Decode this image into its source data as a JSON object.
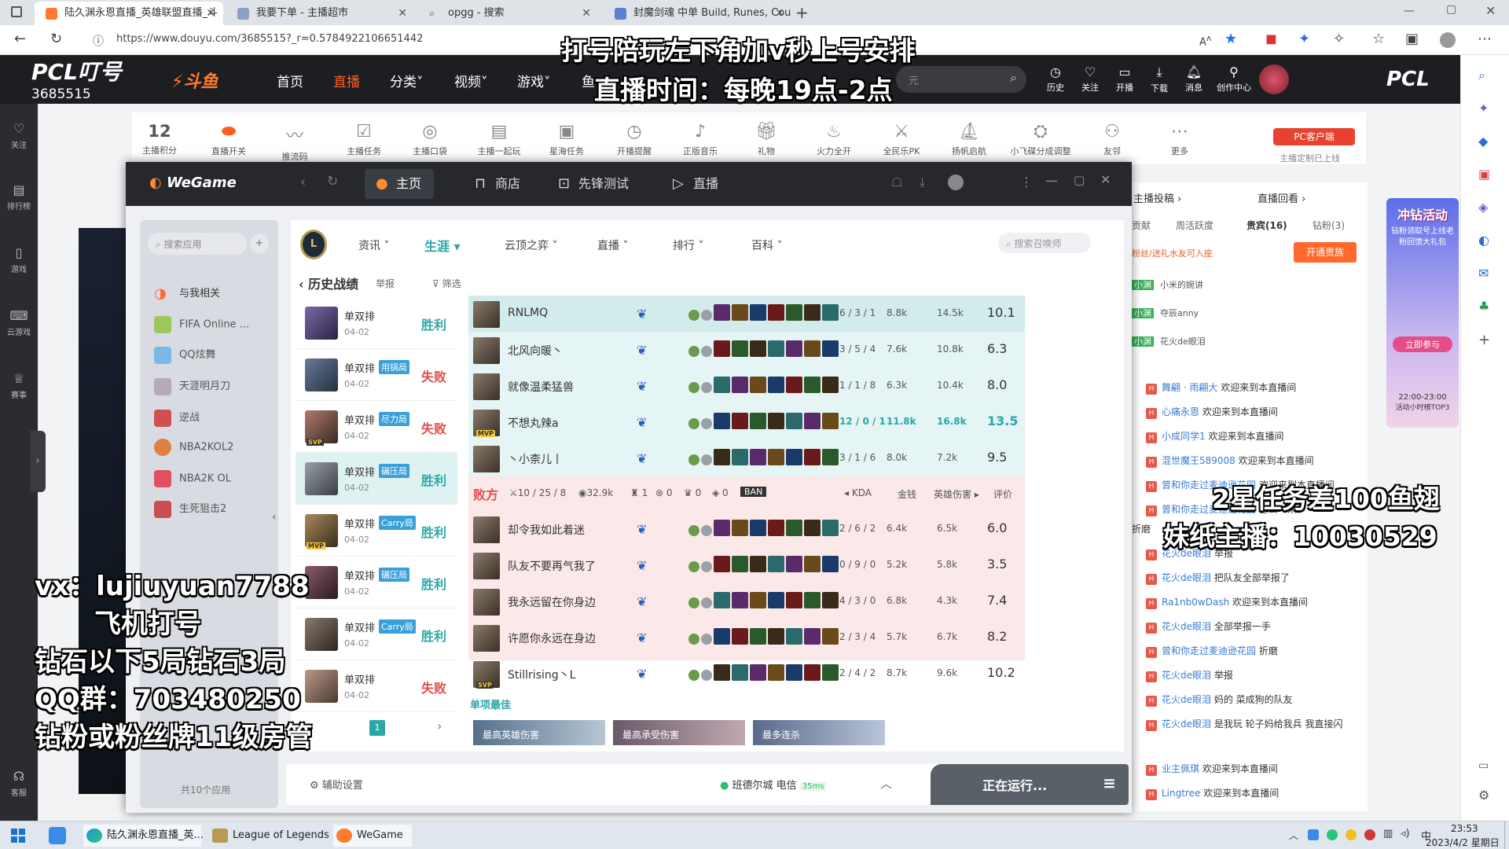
{
  "browser": {
    "tabs": [
      {
        "label": "陆久渊永恩直播_英雄联盟直播_斗",
        "active": true
      },
      {
        "label": "我要下单 - 主播超市",
        "active": false
      },
      {
        "label": "opgg - 搜索",
        "active": false
      },
      {
        "label": "封魔剑魂 中单 Build, Runes, Cou",
        "active": false
      }
    ],
    "url": "https://www.douyu.com/3685515?_r=0.5784922106651442"
  },
  "douyu": {
    "room_logo": "PCL叮号",
    "room_number": "3685515",
    "brand": "斗鱼",
    "nav": [
      "首页",
      "直播",
      "分类",
      "视频",
      "游戏",
      "鱼"
    ],
    "search_placeholder": "元",
    "header_icons": [
      "历史",
      "关注",
      "开播",
      "下载",
      "消息",
      "创作中心"
    ],
    "right_logo": "PCL",
    "left_rail": [
      "关注",
      "排行榜",
      "游戏",
      "云游戏",
      "赛事",
      "客服"
    ],
    "toolbar": [
      {
        "label": "主播积分",
        "value": "12"
      },
      {
        "label": "直播开关"
      },
      {
        "label": "推流码"
      },
      {
        "label": "主播任务"
      },
      {
        "label": "主播口袋"
      },
      {
        "label": "主播一起玩"
      },
      {
        "label": "星海任务"
      },
      {
        "label": "开播提醒"
      },
      {
        "label": "正版音乐"
      },
      {
        "label": "礼物"
      },
      {
        "label": "火力全开"
      },
      {
        "label": "全民乐PK"
      },
      {
        "label": "扬帆启航"
      },
      {
        "label": "小飞碟分成调整"
      },
      {
        "label": "友邻"
      },
      {
        "label": "更多"
      }
    ],
    "pc_client_button": "PC客户端",
    "pc_client_note": "主播定制已上线"
  },
  "chat": {
    "tabs": [
      "主播投稿",
      "直播回看"
    ],
    "subtabs": [
      "贡献",
      "周活跃度",
      "贵宾(16)",
      "钻粉(3)"
    ],
    "vip_button": "开通贵族",
    "notice": "粉丝/送礼水友可入座",
    "fans": [
      {
        "user": "小米的婉讲"
      },
      {
        "user": "夺辰anny"
      },
      {
        "user": "花火de眼泪"
      }
    ],
    "messages": [
      {
        "user": "舞翩 · 雨翩大",
        "text": "欢迎来到本直播间"
      },
      {
        "user": "心痛永恩",
        "text": "欢迎来到本直播间"
      },
      {
        "user": "小成同学1",
        "text": "欢迎来到本直播间"
      },
      {
        "user": "混世魔王589008",
        "text": "欢迎来到本直播间"
      },
      {
        "user": "曾和你走过麦迪逊花园",
        "text": "欢迎来到本直播间"
      },
      {
        "user": "曾和你走过麦迪逊花园",
        "text": "怎么一来"
      },
      {
        "user": "",
        "text": "折磨"
      },
      {
        "user": "花火de眼泪",
        "text": "举报"
      },
      {
        "user": "花火de眼泪",
        "text": "把队友全部举报了"
      },
      {
        "user": "Ra1nb0wDash",
        "text": "欢迎来到本直播间"
      },
      {
        "user": "花火de眼泪",
        "text": "全部举报一手"
      },
      {
        "user": "曾和你走过麦迪逊花园",
        "text": "折磨"
      },
      {
        "user": "花火de眼泪",
        "text": "举报"
      },
      {
        "user": "花火de眼泪",
        "text": "妈的 菜成狗的队友"
      },
      {
        "user": "花火de眼泪",
        "text": "是我玩 轮子妈给我兵 我直接闪"
      },
      {
        "user": "业主佩琪",
        "text": "欢迎来到本直播间"
      },
      {
        "user": "Lingtree",
        "text": "欢迎来到本直播间"
      }
    ],
    "promo": {
      "title": "冲钻活动",
      "sub": "钻粉领取号上线老粉回馈大礼包",
      "button": "立即参与",
      "time": "22:00-23:00",
      "note": "活动小时榜TOP3"
    }
  },
  "wegame": {
    "brand": "WeGame",
    "tabs": [
      "主页",
      "商店",
      "先锋测试",
      "直播"
    ],
    "search_app_placeholder": "搜索应用",
    "sidebar": [
      "与我相关",
      "FIFA Online ...",
      "QQ炫舞",
      "天涯明月刀",
      "逆战",
      "NBA2KOL2",
      "NBA2K OL",
      "生死狙击2"
    ],
    "sidebar_count": "共10个应用",
    "settings_label": "辅助设置",
    "server": "班德尔城 电信",
    "ping": "35ms",
    "running": "正在运行...",
    "lol": {
      "categories": [
        "资讯",
        "生涯",
        "云顶之弈",
        "直播",
        "排行",
        "百科"
      ],
      "active_category": "生涯",
      "search_placeholder": "搜索召唤师",
      "history_title": "历史战绩",
      "report": "举报",
      "filter": "筛选",
      "page": "1",
      "history": [
        {
          "mode": "单双排",
          "tag": "",
          "date": "04-02",
          "result": "胜利",
          "win": true
        },
        {
          "mode": "单双排",
          "tag": "用锅局",
          "date": "04-02",
          "result": "失败",
          "win": false
        },
        {
          "mode": "单双排",
          "tag": "尽力局",
          "date": "04-02",
          "result": "失败",
          "win": false,
          "badge": "SVP"
        },
        {
          "mode": "单双排",
          "tag": "碾压局",
          "date": "04-02",
          "result": "胜利",
          "win": true
        },
        {
          "mode": "单双排",
          "tag": "Carry局",
          "date": "04-02",
          "result": "胜利",
          "win": true,
          "badge": "MVP"
        },
        {
          "mode": "单双排",
          "tag": "碾压局",
          "date": "04-02",
          "result": "胜利",
          "win": true
        },
        {
          "mode": "单双排",
          "tag": "Carry局",
          "date": "04-02",
          "result": "胜利",
          "win": true
        },
        {
          "mode": "单双排",
          "tag": "",
          "date": "04-02",
          "result": "失败",
          "win": false
        }
      ],
      "win_team": [
        {
          "name": "RNLMQ",
          "kda": "6 / 3 / 1",
          "gold": "8.8k",
          "dmg": "14.5k",
          "score": "10.1"
        },
        {
          "name": "北风向暖丶",
          "kda": "3 / 5 / 4",
          "gold": "7.6k",
          "dmg": "10.8k",
          "score": "6.3"
        },
        {
          "name": "就像温柔猛兽",
          "kda": "1 / 1 / 8",
          "gold": "6.3k",
          "dmg": "10.4k",
          "score": "8.0"
        },
        {
          "name": "不想丸辣a",
          "kda": "12 / 0 / 1",
          "gold": "11.8k",
          "dmg": "16.8k",
          "score": "13.5",
          "mvp": true
        },
        {
          "name": "丶小柰儿丨",
          "kda": "3 / 1 / 6",
          "gold": "8.0k",
          "dmg": "7.2k",
          "score": "9.5"
        }
      ],
      "lose_header": {
        "label": "败方",
        "kda": "10 / 25 / 8",
        "gold": "32.9k",
        "towers": "1",
        "dragons": "0",
        "barons": "0",
        "heralds": "0",
        "ban": "BAN",
        "col_kda": "KDA",
        "col_gold": "金钱",
        "col_dmg": "英雄伤害",
        "col_score": "评价"
      },
      "lose_team": [
        {
          "name": "却令我如此着迷",
          "kda": "2 / 6 / 2",
          "gold": "6.4k",
          "dmg": "6.5k",
          "score": "6.0"
        },
        {
          "name": "队友不要再气我了",
          "kda": "0 / 9 / 0",
          "gold": "5.2k",
          "dmg": "5.8k",
          "score": "3.5"
        },
        {
          "name": "我永远留在你身边",
          "kda": "4 / 3 / 0",
          "gold": "6.8k",
          "dmg": "4.3k",
          "score": "7.4"
        },
        {
          "name": "许愿你永远在身边",
          "kda": "2 / 3 / 4",
          "gold": "5.7k",
          "dmg": "6.7k",
          "score": "8.2"
        },
        {
          "name": "Stillrising丶L",
          "kda": "2 / 4 / 2",
          "gold": "8.7k",
          "dmg": "9.6k",
          "score": "10.2",
          "svp": true
        }
      ],
      "highlights_title": "单项最佳",
      "highlights": [
        "最高英雄伤害",
        "最高承受伤害",
        "最多连杀"
      ]
    }
  },
  "overlays": {
    "top1": "打号陪玩左下角加v秒上号安排",
    "top2": "直播时间：每晚19点-2点",
    "right1": "2星任务差100鱼翅",
    "right2": "妹纸主播：10030529",
    "left": [
      "vx：lujiuyuan7788",
      "飞机打号",
      "钻石以下5局钻石3局",
      "QQ群：703480250",
      "钻粉或粉丝牌11级房管"
    ]
  },
  "taskbar": {
    "items": [
      "陆久渊永恩直播_英...",
      "League of Legends",
      "WeGame"
    ],
    "time": "23:53",
    "date": "2023/4/2 星期日",
    "ime": "中"
  },
  "colors": {
    "win": "#2aa8a8",
    "lose": "#e24c4c",
    "douyu_orange": "#ff5d23"
  }
}
